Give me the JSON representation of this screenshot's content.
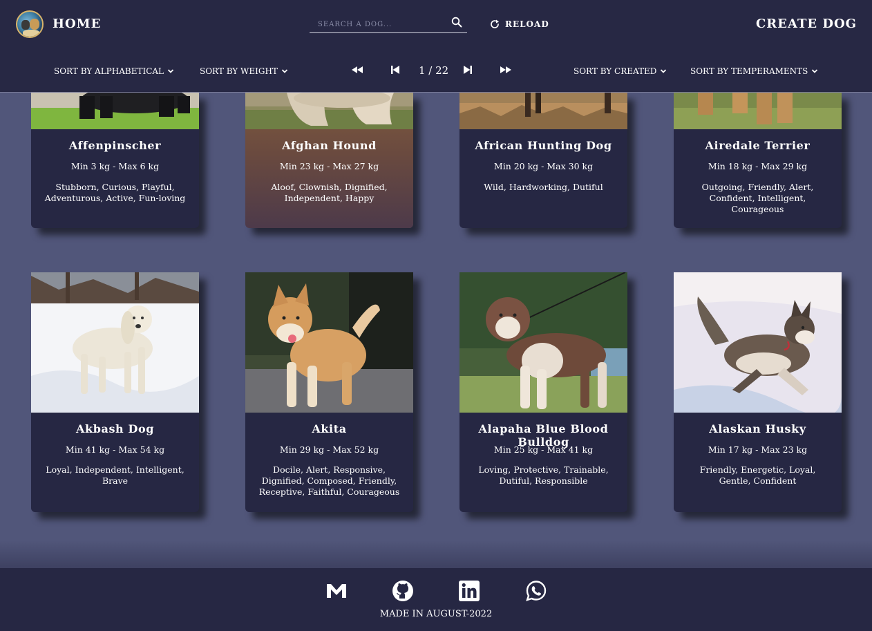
{
  "header": {
    "home_label": "HOME",
    "search_placeholder": "SEARCH A DOG...",
    "search_value": "",
    "reload_label": "RELOAD",
    "create_label": "CREATE DOG"
  },
  "filters": {
    "sort_alphabetical": "SORT BY ALPHABETICAL",
    "sort_weight": "SORT BY WEIGHT",
    "sort_created": "SORT BY CREATED",
    "sort_temperaments": "SORT BY TEMPERAMENTS"
  },
  "pagination": {
    "current": "1 / 22"
  },
  "dogs": [
    {
      "name": "Affenpinscher",
      "weight": "Min 3 kg - Max 6 kg",
      "temperaments": "Stubborn, Curious, Playful, Adventurous, Active, Fun-loving"
    },
    {
      "name": "Afghan Hound",
      "weight": "Min 23 kg - Max 27 kg",
      "temperaments": "Aloof, Clownish, Dignified, Independent, Happy"
    },
    {
      "name": "African Hunting Dog",
      "weight": "Min 20 kg - Max 30 kg",
      "temperaments": "Wild, Hardworking, Dutiful"
    },
    {
      "name": "Airedale Terrier",
      "weight": "Min 18 kg - Max 29 kg",
      "temperaments": "Outgoing, Friendly, Alert, Confident, Intelligent, Courageous"
    },
    {
      "name": "Akbash Dog",
      "weight": "Min 41 kg - Max 54 kg",
      "temperaments": "Loyal, Independent, Intelligent, Brave"
    },
    {
      "name": "Akita",
      "weight": "Min 29 kg - Max 52 kg",
      "temperaments": "Docile, Alert, Responsive, Dignified, Composed, Friendly, Receptive, Faithful, Courageous"
    },
    {
      "name": "Alapaha Blue Blood Bulldog",
      "weight": "Min 25 kg - Max 41 kg",
      "temperaments": "Loving, Protective, Trainable, Dutiful, Responsible"
    },
    {
      "name": "Alaskan Husky",
      "weight": "Min 17 kg - Max 23 kg",
      "temperaments": "Friendly, Energetic, Loyal, Gentle, Confident"
    }
  ],
  "footer": {
    "made_in": "MADE IN AUGUST-2022"
  },
  "colors": {
    "page_bg": "#51567a",
    "header_bg": "#272844",
    "card_bg": "#262743",
    "highlight_card": "#7f5a3e"
  }
}
